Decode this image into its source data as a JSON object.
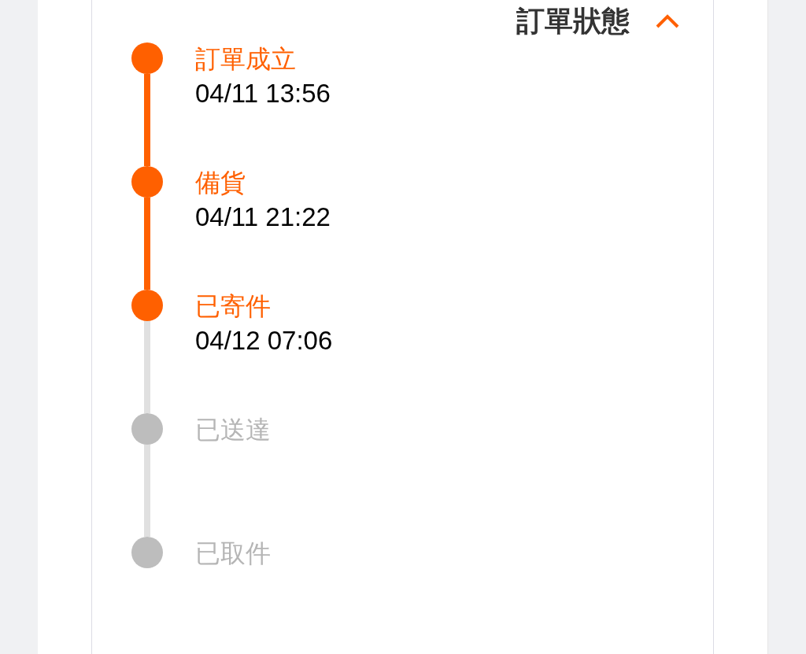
{
  "header": {
    "title": "訂單狀態",
    "expanded": true
  },
  "steps": [
    {
      "label": "訂單成立",
      "time": "04/11 13:56",
      "done": true
    },
    {
      "label": "備貨",
      "time": "04/11 21:22",
      "done": true
    },
    {
      "label": "已寄件",
      "time": "04/12 07:06",
      "done": true
    },
    {
      "label": "已送達",
      "done": false
    },
    {
      "label": "已取件",
      "done": false
    }
  ]
}
